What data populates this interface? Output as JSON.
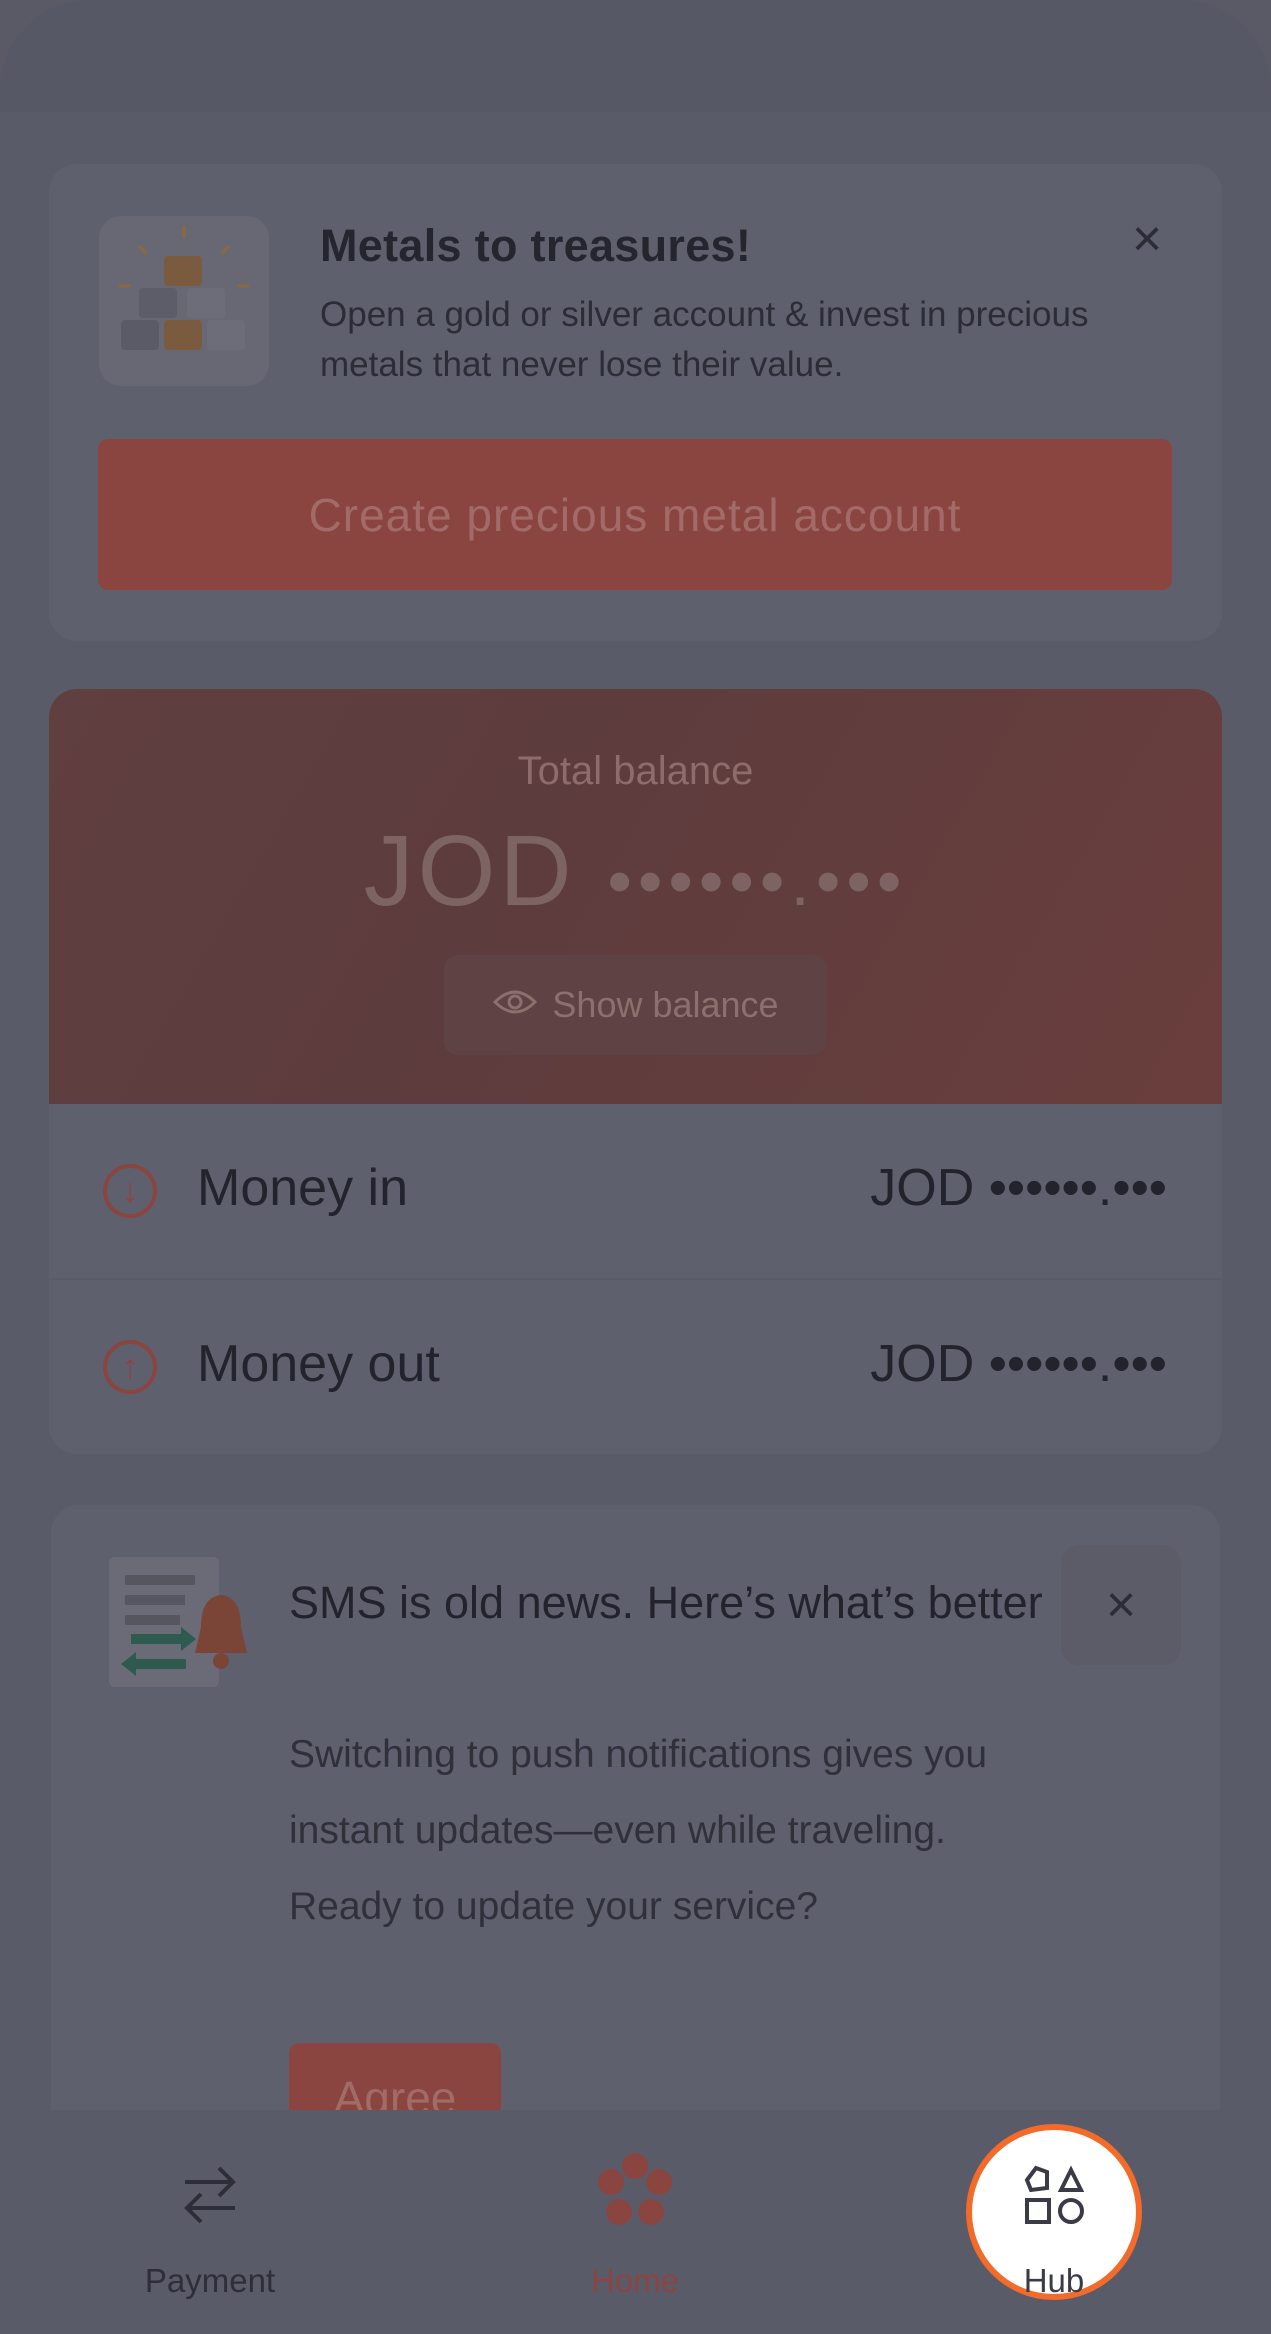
{
  "metal_promo": {
    "title": "Metals to treasures!",
    "description": "Open a gold or silver account & invest in precious metals that never lose their value.",
    "cta_label": "Create precious metal account",
    "close_symbol": "×"
  },
  "balance": {
    "label": "Total balance",
    "currency": "JOD",
    "masked_amount": "••••••.•••",
    "show_button_label": "Show balance"
  },
  "flows": [
    {
      "label": "Money in",
      "value": "JOD ••••••.•••",
      "direction": "down"
    },
    {
      "label": "Money out",
      "value": "JOD ••••••.•••",
      "direction": "up"
    }
  ],
  "sms_promo": {
    "title": "SMS is old news. Here’s what’s better",
    "description": "Switching to push notifications gives you instant updates—even while traveling. Ready to update your service?",
    "agree_label": "Agree",
    "close_symbol": "×"
  },
  "bottom_nav": {
    "items": [
      {
        "label": "Payment",
        "icon": "transfer-arrows-icon"
      },
      {
        "label": "Home",
        "icon": "flower-logo-icon",
        "active": true
      },
      {
        "label": "Hub",
        "icon": "shapes-grid-icon",
        "highlighted": true
      }
    ]
  },
  "colors": {
    "accent": "#8a4541",
    "highlight_ring": "#f36b2b",
    "overlay": "#5a5b68"
  }
}
